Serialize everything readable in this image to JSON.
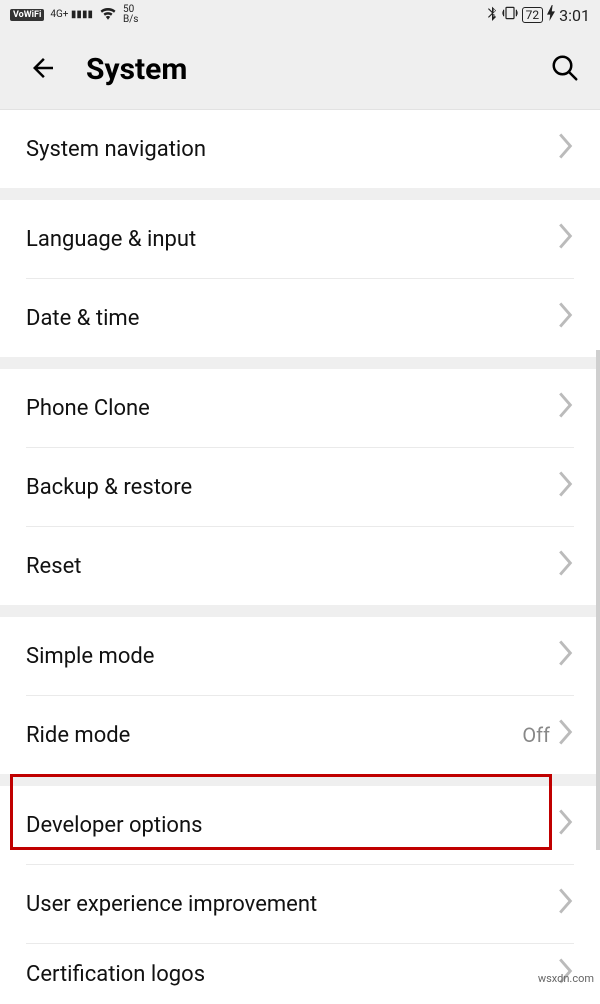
{
  "status": {
    "vowifi": "VoWiFi",
    "signal": "4G+",
    "rate_top": "50",
    "rate_bottom": "B/s",
    "battery": "72",
    "time": "3:01"
  },
  "header": {
    "title": "System"
  },
  "groups": [
    {
      "rows": [
        {
          "label": "System navigation",
          "value": ""
        }
      ]
    },
    {
      "rows": [
        {
          "label": "Language & input",
          "value": ""
        },
        {
          "label": "Date & time",
          "value": ""
        }
      ]
    },
    {
      "rows": [
        {
          "label": "Phone Clone",
          "value": ""
        },
        {
          "label": "Backup & restore",
          "value": ""
        },
        {
          "label": "Reset",
          "value": ""
        }
      ]
    },
    {
      "rows": [
        {
          "label": "Simple mode",
          "value": ""
        },
        {
          "label": "Ride mode",
          "value": "Off"
        }
      ]
    },
    {
      "rows": [
        {
          "label": "Developer options",
          "value": ""
        },
        {
          "label": "User experience improvement",
          "value": ""
        },
        {
          "label": "Certification logos",
          "value": ""
        }
      ]
    }
  ],
  "watermark": "wsxdn.com"
}
